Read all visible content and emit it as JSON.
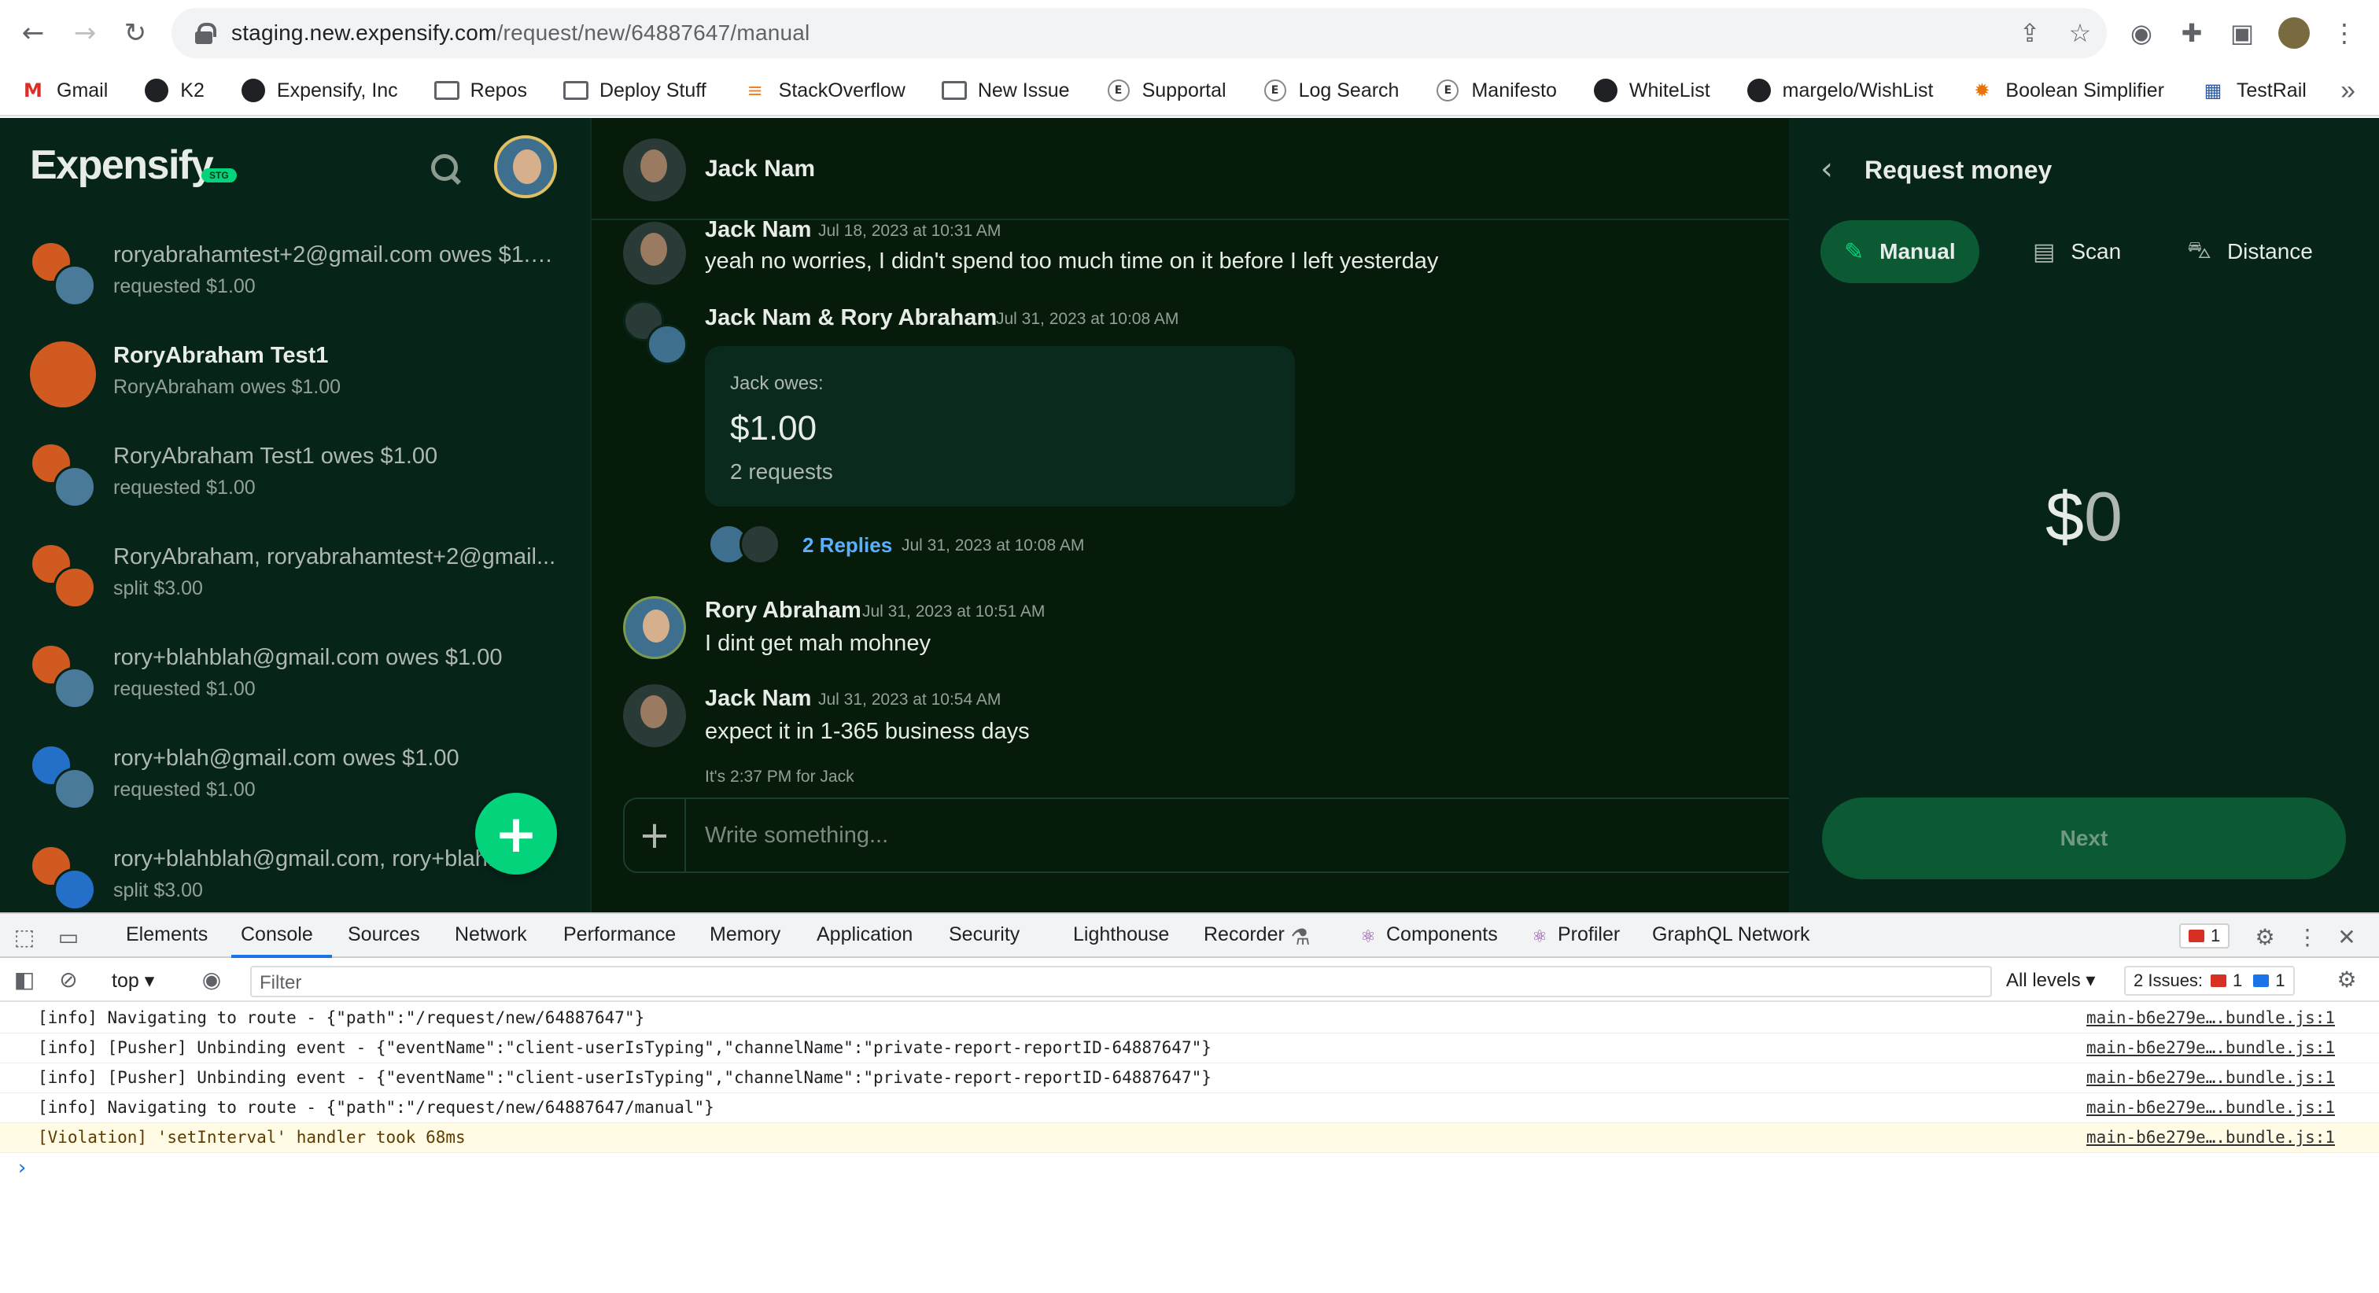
{
  "browser": {
    "url_host": "staging.new.expensify.com",
    "url_path": "/request/new/64887647/manual",
    "bookmarks": [
      {
        "label": "Gmail",
        "icon": "gmail-icon"
      },
      {
        "label": "K2",
        "icon": "github-icon"
      },
      {
        "label": "Expensify, Inc",
        "icon": "github-icon"
      },
      {
        "label": "Repos",
        "icon": "folder-icon"
      },
      {
        "label": "Deploy Stuff",
        "icon": "folder-icon"
      },
      {
        "label": "StackOverflow",
        "icon": "stackoverflow-icon"
      },
      {
        "label": "New Issue",
        "icon": "folder-icon"
      },
      {
        "label": "Supportal",
        "icon": "expensify-icon"
      },
      {
        "label": "Log Search",
        "icon": "expensify-icon"
      },
      {
        "label": "Manifesto",
        "icon": "expensify-icon"
      },
      {
        "label": "WhiteList",
        "icon": "github-icon"
      },
      {
        "label": "margelo/WishList",
        "icon": "github-icon"
      },
      {
        "label": "Boolean Simplifier",
        "icon": "gear-icon"
      },
      {
        "label": "TestRail",
        "icon": "testrail-icon"
      }
    ],
    "more": "»"
  },
  "lhn": {
    "logo": "Expensify",
    "badge": "STG",
    "chats": [
      {
        "title": "roryabrahamtest+2@gmail.com owes $1.0...",
        "subtitle": "requested $1.00",
        "bold": false
      },
      {
        "title": "RoryAbraham Test1",
        "subtitle": "RoryAbraham owes $1.00",
        "bold": true
      },
      {
        "title": "RoryAbraham Test1 owes $1.00",
        "subtitle": "requested $1.00",
        "bold": false
      },
      {
        "title": "RoryAbraham, roryabrahamtest+2@gmail...",
        "subtitle": "split $3.00",
        "bold": false
      },
      {
        "title": "rory+blahblah@gmail.com owes $1.00",
        "subtitle": "requested $1.00",
        "bold": false
      },
      {
        "title": "rory+blah@gmail.com owes $1.00",
        "subtitle": "requested $1.00",
        "bold": false
      },
      {
        "title": "rory+blahblah@gmail.com, rory+blah...",
        "subtitle": "split $3.00",
        "bold": false
      }
    ],
    "fab": "+"
  },
  "report": {
    "header_name": "Jack Nam",
    "messages": [
      {
        "name": "Jack Nam",
        "time": "Jul 18, 2023 at 10:31 AM",
        "text": "yeah no worries, I didn't spend too much time on it before I left yesterday"
      },
      {
        "name": "Jack Nam & Rory Abraham",
        "time": "Jul 31, 2023 at 10:08 AM"
      },
      {
        "name": "Rory Abraham",
        "time": "Jul 31, 2023 at 10:51 AM",
        "text": "I dint get mah mohney"
      },
      {
        "name": "Jack Nam",
        "time": "Jul 31, 2023 at 10:54 AM",
        "text": "expect it in 1-365 business days"
      }
    ],
    "iou": {
      "label": "Jack owes:",
      "amount": "$1.00",
      "sub": "2 requests"
    },
    "replies": {
      "label": "2 Replies",
      "time": "Jul 31, 2023 at 10:08 AM"
    },
    "local_time": "It's 2:37 PM for Jack",
    "composer_placeholder": "Write something...",
    "composer_plus": "+"
  },
  "rhp": {
    "title": "Request money",
    "tabs": [
      {
        "label": "Manual",
        "icon": "pencil-icon",
        "active": true
      },
      {
        "label": "Scan",
        "icon": "receipt-icon",
        "active": false
      },
      {
        "label": "Distance",
        "icon": "car-icon",
        "active": false
      }
    ],
    "currency": "$",
    "amount": "0",
    "next_label": "Next"
  },
  "devtools": {
    "tabs": [
      "Elements",
      "Console",
      "Sources",
      "Network",
      "Performance",
      "Memory",
      "Application",
      "Security",
      "Lighthouse",
      "Recorder",
      "Components",
      "Profiler",
      "GraphQL Network"
    ],
    "active_tab": "Console",
    "error_count": "1",
    "context": "top",
    "filter_placeholder": "Filter",
    "levels": "All levels",
    "issues_label": "2 Issues:",
    "issues_errors": "1",
    "issues_info": "1",
    "logs": [
      {
        "text": "[info] Navigating to route - {\"path\":\"/request/new/64887647\"}",
        "source": "main-b6e279e….bundle.js:1",
        "level": "info"
      },
      {
        "text": "[info] [Pusher] Unbinding event - {\"eventName\":\"client-userIsTyping\",\"channelName\":\"private-report-reportID-64887647\"}",
        "source": "main-b6e279e….bundle.js:1",
        "level": "info"
      },
      {
        "text": "[info] [Pusher] Unbinding event - {\"eventName\":\"client-userIsTyping\",\"channelName\":\"private-report-reportID-64887647\"}",
        "source": "main-b6e279e….bundle.js:1",
        "level": "info"
      },
      {
        "text": "[info] Navigating to route - {\"path\":\"/request/new/64887647/manual\"}",
        "source": "main-b6e279e….bundle.js:1",
        "level": "info"
      },
      {
        "text": "[Violation] 'setInterval' handler took 68ms",
        "source": "main-b6e279e….bundle.js:1",
        "level": "warn"
      }
    ],
    "prompt": "›"
  },
  "colors": {
    "accent": "#03d47c",
    "app_bg": "#061b09",
    "lhn_bg": "#072419",
    "link": "#5ab0ff"
  }
}
